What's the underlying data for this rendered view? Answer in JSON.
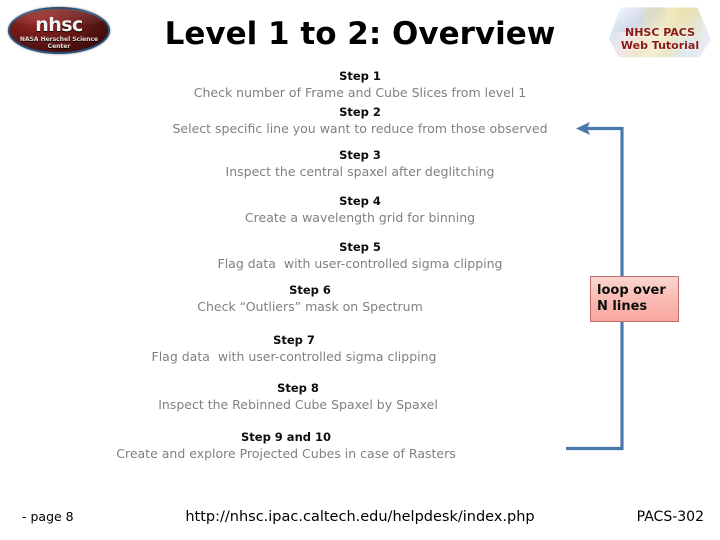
{
  "slide": {
    "title": "Level 1 to 2: Overview",
    "background_color": "#ffffff"
  },
  "logo": {
    "word": "nhsc",
    "sub_line1": "NASA Herschel Science",
    "sub_line2": "Center",
    "oval_color": "#6e1a18"
  },
  "badge": {
    "line1": "NHSC PACS",
    "line2": "Web Tutorial",
    "text_color": "#8b1a15"
  },
  "steps": [
    {
      "head": "Step 1",
      "desc": "Check number of Frame and Cube Slices from level 1",
      "head_color": "#0d0d0d",
      "desc_color": "#808080"
    },
    {
      "head": "Step 2",
      "desc": "Select specific line you want to reduce from those observed",
      "head_color": "#0d0d0d",
      "desc_color": "#808080"
    },
    {
      "head": "Step 3",
      "desc": "Inspect the central spaxel after deglitching",
      "head_color": "#0d0d0d",
      "desc_color": "#808080"
    },
    {
      "head": "Step 4",
      "desc": "Create a wavelength grid for binning",
      "head_color": "#0d0d0d",
      "desc_color": "#808080"
    },
    {
      "head": "Step 5",
      "desc": "Flag data  with user-controlled sigma clipping",
      "head_color": "#0d0d0d",
      "desc_color": "#808080"
    },
    {
      "head": "Step 6",
      "desc": "Check “Outliers” mask on Spectrum",
      "head_color": "#0d0d0d",
      "desc_color": "#808080"
    },
    {
      "head": "Step 7",
      "desc": "Flag data  with user-controlled sigma clipping",
      "head_color": "#0d0d0d",
      "desc_color": "#808080"
    },
    {
      "head": "Step 8",
      "desc": "Inspect the Rebinned Cube Spaxel by Spaxel",
      "head_color": "#0d0d0d",
      "desc_color": "#808080"
    },
    {
      "head": "Step 9 and 10",
      "desc": "Create and explore Projected Cubes in case of Rasters",
      "head_color": "#0d0d0d",
      "desc_color": "#808080"
    }
  ],
  "loop_box": {
    "line1": "loop over",
    "line2": "N lines",
    "fill_color": "#f9b9b1",
    "border_color": "#c06a69"
  },
  "connector": {
    "color": "#4a7aad",
    "arrow_direction": "left"
  },
  "footer": {
    "page_label": "- page 8",
    "url": "http://nhsc.ipac.caltech.edu/helpdesk/index.php",
    "doc_code": "PACS-302"
  }
}
